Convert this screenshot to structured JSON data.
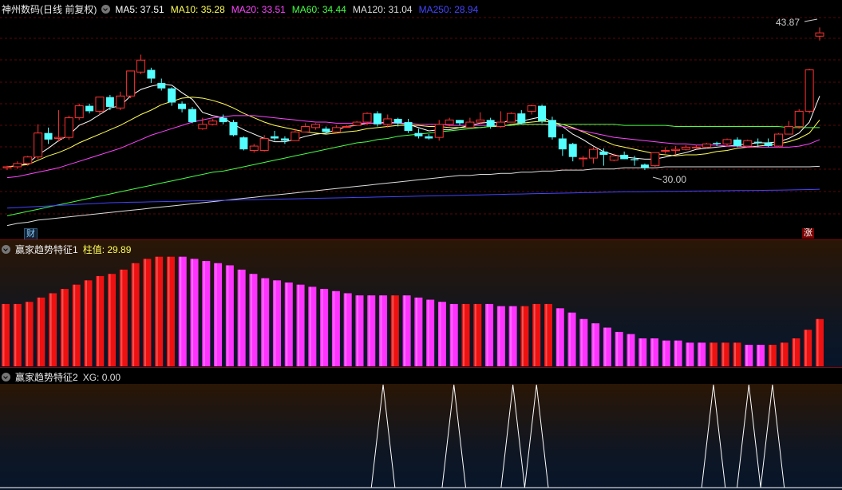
{
  "main": {
    "title": "神州数码(日线 前复权)",
    "indicators": [
      {
        "label": "MA5: 37.51",
        "color": "#ffffff"
      },
      {
        "label": "MA10: 35.28",
        "color": "#ffff55"
      },
      {
        "label": "MA20: 33.51",
        "color": "#ff44ff"
      },
      {
        "label": "MA60: 34.44",
        "color": "#44ff44"
      },
      {
        "label": "MA120: 31.04",
        "color": "#dddddd"
      },
      {
        "label": "MA250: 28.94",
        "color": "#4444ff"
      }
    ],
    "high_label": "43.87",
    "low_label": "30.00",
    "badge_cai": "财",
    "badge_zhang": "涨"
  },
  "indicator1": {
    "title": "赢家趋势特征1",
    "value_label": "柱值: 29.89",
    "bars": [
      {
        "v": 29,
        "c": "r"
      },
      {
        "v": 29,
        "c": "r"
      },
      {
        "v": 30,
        "c": "r"
      },
      {
        "v": 32,
        "c": "r"
      },
      {
        "v": 34,
        "c": "r"
      },
      {
        "v": 36,
        "c": "r"
      },
      {
        "v": 38,
        "c": "r"
      },
      {
        "v": 40,
        "c": "r"
      },
      {
        "v": 42,
        "c": "r"
      },
      {
        "v": 43,
        "c": "r"
      },
      {
        "v": 45,
        "c": "r"
      },
      {
        "v": 48,
        "c": "r"
      },
      {
        "v": 50,
        "c": "r"
      },
      {
        "v": 51,
        "c": "r"
      },
      {
        "v": 51,
        "c": "r"
      },
      {
        "v": 51,
        "c": "m"
      },
      {
        "v": 50,
        "c": "m"
      },
      {
        "v": 49,
        "c": "m"
      },
      {
        "v": 48,
        "c": "m"
      },
      {
        "v": 47,
        "c": "m"
      },
      {
        "v": 45,
        "c": "m"
      },
      {
        "v": 43,
        "c": "m"
      },
      {
        "v": 41,
        "c": "m"
      },
      {
        "v": 40,
        "c": "m"
      },
      {
        "v": 39,
        "c": "m"
      },
      {
        "v": 38,
        "c": "m"
      },
      {
        "v": 37,
        "c": "m"
      },
      {
        "v": 36,
        "c": "m"
      },
      {
        "v": 35,
        "c": "m"
      },
      {
        "v": 34,
        "c": "m"
      },
      {
        "v": 33,
        "c": "m"
      },
      {
        "v": 33,
        "c": "m"
      },
      {
        "v": 33,
        "c": "m"
      },
      {
        "v": 33,
        "c": "r"
      },
      {
        "v": 33,
        "c": "m"
      },
      {
        "v": 32,
        "c": "m"
      },
      {
        "v": 31,
        "c": "m"
      },
      {
        "v": 30,
        "c": "m"
      },
      {
        "v": 29,
        "c": "m"
      },
      {
        "v": 29,
        "c": "r"
      },
      {
        "v": 29,
        "c": "r"
      },
      {
        "v": 29,
        "c": "m"
      },
      {
        "v": 28,
        "c": "m"
      },
      {
        "v": 28,
        "c": "m"
      },
      {
        "v": 28,
        "c": "r"
      },
      {
        "v": 29,
        "c": "r"
      },
      {
        "v": 29,
        "c": "r"
      },
      {
        "v": 27,
        "c": "m"
      },
      {
        "v": 25,
        "c": "m"
      },
      {
        "v": 22,
        "c": "m"
      },
      {
        "v": 20,
        "c": "m"
      },
      {
        "v": 18,
        "c": "m"
      },
      {
        "v": 16,
        "c": "m"
      },
      {
        "v": 15,
        "c": "m"
      },
      {
        "v": 13,
        "c": "m"
      },
      {
        "v": 13,
        "c": "m"
      },
      {
        "v": 12,
        "c": "m"
      },
      {
        "v": 12,
        "c": "m"
      },
      {
        "v": 11,
        "c": "m"
      },
      {
        "v": 11,
        "c": "m"
      },
      {
        "v": 11,
        "c": "r"
      },
      {
        "v": 11,
        "c": "r"
      },
      {
        "v": 11,
        "c": "r"
      },
      {
        "v": 10,
        "c": "m"
      },
      {
        "v": 10,
        "c": "m"
      },
      {
        "v": 10,
        "c": "r"
      },
      {
        "v": 11,
        "c": "r"
      },
      {
        "v": 13,
        "c": "r"
      },
      {
        "v": 17,
        "c": "r"
      },
      {
        "v": 22,
        "c": "r"
      }
    ],
    "colors": {
      "r": "#ee1111",
      "m": "#ff33ff"
    }
  },
  "indicator2": {
    "title": "赢家趋势特征2",
    "value_label": "XG: 0.00",
    "spikes": [
      32,
      38,
      43,
      45,
      60,
      63,
      65
    ]
  },
  "chart_data": {
    "type": "candlestick",
    "candles": [
      [
        30.9,
        31.0,
        30.7,
        31.1
      ],
      [
        31.0,
        31.3,
        30.8,
        31.5
      ],
      [
        31.3,
        31.9,
        31.1,
        32.0
      ],
      [
        31.9,
        34.1,
        31.7,
        34.9
      ],
      [
        34.1,
        33.5,
        33.1,
        34.6
      ],
      [
        33.6,
        33.7,
        33.3,
        36.2
      ],
      [
        33.7,
        35.5,
        33.5,
        35.7
      ],
      [
        35.5,
        36.6,
        35.3,
        36.8
      ],
      [
        36.6,
        36.1,
        35.9,
        36.8
      ],
      [
        36.1,
        37.4,
        35.8,
        37.4
      ],
      [
        37.4,
        36.5,
        36.2,
        37.6
      ],
      [
        36.4,
        37.5,
        36.2,
        37.9
      ],
      [
        37.5,
        39.8,
        37.3,
        39.8
      ],
      [
        39.7,
        40.8,
        39.5,
        41.3
      ],
      [
        39.9,
        39.1,
        38.7,
        40.1
      ],
      [
        38.7,
        38.2,
        38.0,
        39.1
      ],
      [
        38.2,
        36.9,
        36.6,
        38.3
      ],
      [
        36.8,
        36.3,
        36.0,
        37.0
      ],
      [
        36.3,
        35.1,
        35.0,
        36.5
      ],
      [
        34.5,
        34.9,
        34.4,
        35.5
      ],
      [
        34.9,
        35.2,
        34.8,
        35.4
      ],
      [
        35.5,
        35.1,
        34.9,
        35.8
      ],
      [
        35.1,
        33.9,
        33.8,
        35.3
      ],
      [
        33.7,
        32.6,
        32.5,
        33.8
      ],
      [
        32.5,
        32.9,
        32.3,
        33.1
      ],
      [
        32.5,
        33.6,
        32.4,
        33.9
      ],
      [
        33.8,
        33.6,
        33.4,
        34.3
      ],
      [
        33.6,
        33.4,
        33.1,
        33.8
      ],
      [
        33.4,
        34.2,
        33.4,
        34.5
      ],
      [
        34.2,
        34.7,
        34.2,
        35.0
      ],
      [
        34.6,
        34.9,
        34.4,
        35.0
      ],
      [
        34.5,
        34.2,
        34.0,
        34.7
      ],
      [
        34.2,
        34.6,
        34.1,
        34.8
      ],
      [
        34.7,
        34.7,
        34.7,
        34.8
      ],
      [
        34.8,
        35.1,
        34.8,
        35.2
      ],
      [
        35.1,
        35.9,
        34.8,
        36.0
      ],
      [
        35.9,
        34.9,
        34.7,
        36.1
      ],
      [
        34.9,
        35.4,
        34.6,
        35.8
      ],
      [
        35.4,
        35.0,
        34.7,
        35.5
      ],
      [
        35.1,
        34.3,
        34.1,
        35.4
      ],
      [
        34.1,
        33.8,
        33.6,
        34.5
      ],
      [
        33.8,
        33.6,
        33.5,
        34.0
      ],
      [
        33.7,
        34.9,
        33.4,
        35.3
      ],
      [
        34.9,
        35.3,
        34.7,
        35.5
      ],
      [
        35.3,
        35.0,
        34.8,
        35.3
      ],
      [
        34.6,
        35.1,
        34.6,
        35.5
      ],
      [
        35.1,
        35.3,
        34.9,
        36.0
      ],
      [
        35.3,
        34.7,
        34.5,
        35.5
      ],
      [
        34.7,
        35.1,
        34.6,
        36.1
      ],
      [
        35.1,
        35.9,
        35.1,
        36.0
      ],
      [
        35.9,
        35.0,
        34.9,
        36.2
      ],
      [
        36.1,
        36.6,
        35.8,
        36.7
      ],
      [
        36.6,
        35.2,
        35.0,
        36.7
      ],
      [
        35.3,
        33.7,
        33.5,
        35.6
      ],
      [
        33.6,
        32.6,
        32.0,
        34.0
      ],
      [
        33.1,
        31.9,
        31.5,
        33.2
      ],
      [
        31.8,
        31.8,
        31.0,
        32.0
      ],
      [
        31.8,
        32.6,
        31.3,
        32.8
      ],
      [
        32.4,
        32.1,
        31.1,
        32.7
      ],
      [
        31.6,
        32.0,
        31.5,
        32.2
      ],
      [
        32.1,
        31.7,
        31.7,
        32.4
      ],
      [
        31.7,
        31.6,
        31.1,
        32.0
      ],
      [
        31.2,
        30.9,
        30.7,
        31.3
      ],
      [
        31.1,
        32.3,
        31.0,
        32.3
      ],
      [
        32.5,
        32.5,
        32.2,
        32.8
      ],
      [
        32.5,
        32.6,
        32.1,
        32.9
      ],
      [
        32.6,
        32.8,
        32.5,
        33.0
      ],
      [
        32.8,
        32.8,
        32.7,
        33.0
      ],
      [
        32.8,
        33.1,
        32.7,
        33.2
      ],
      [
        33.2,
        33.1,
        32.9,
        33.3
      ],
      [
        33.1,
        33.5,
        32.9,
        33.6
      ],
      [
        33.5,
        32.9,
        32.8,
        33.7
      ],
      [
        32.9,
        33.4,
        32.8,
        33.5
      ],
      [
        33.3,
        33.2,
        32.8,
        33.6
      ],
      [
        33.2,
        32.9,
        32.8,
        33.6
      ],
      [
        32.9,
        34.0,
        32.8,
        34.1
      ],
      [
        34.0,
        34.7,
        34.0,
        35.2
      ],
      [
        34.7,
        36.1,
        34.5,
        36.3
      ],
      [
        36.1,
        39.9,
        35.9,
        40.0
      ],
      [
        43.0,
        43.3,
        42.6,
        43.8
      ]
    ],
    "moving_averages": [
      {
        "name": "MA5",
        "color": "#ffffff",
        "values": [
          31.0,
          31.1,
          31.3,
          32.1,
          32.7,
          33.4,
          33.9,
          34.8,
          35.2,
          35.8,
          36.4,
          36.6,
          37.5,
          38.1,
          38.4,
          38.6,
          38.5,
          37.8,
          37.2,
          36.0,
          35.7,
          35.5,
          34.9,
          34.4,
          34.0,
          33.6,
          33.3,
          33.3,
          33.5,
          33.8,
          34.0,
          34.1,
          34.4,
          34.7,
          34.8,
          35.0,
          35.0,
          35.1,
          35.0,
          34.9,
          34.6,
          34.3,
          34.4,
          34.4,
          34.6,
          34.8,
          35.0,
          35.1,
          35.0,
          35.3,
          35.2,
          35.4,
          35.6,
          35.1,
          34.7,
          34.0,
          33.5,
          32.9,
          32.4,
          32.1,
          31.9,
          31.8,
          31.7,
          31.7,
          31.9,
          32.1,
          32.3,
          32.6,
          32.7,
          32.8,
          32.9,
          33.0,
          33.1,
          33.2,
          33.2,
          33.3,
          33.6,
          34.1,
          35.1,
          37.5
        ]
      },
      {
        "name": "MA10",
        "color": "#ffff55",
        "values": [
          31.0,
          31.1,
          31.2,
          31.6,
          32.0,
          32.3,
          32.7,
          33.2,
          33.6,
          34.0,
          34.4,
          34.8,
          35.3,
          35.8,
          36.2,
          36.7,
          37.0,
          37.3,
          37.4,
          37.3,
          37.1,
          36.8,
          36.4,
          35.9,
          35.5,
          35.1,
          34.8,
          34.6,
          34.4,
          34.2,
          34.1,
          34.0,
          34.1,
          34.2,
          34.3,
          34.5,
          34.6,
          34.7,
          34.8,
          34.8,
          34.8,
          34.7,
          34.7,
          34.6,
          34.6,
          34.6,
          34.6,
          34.7,
          34.7,
          34.9,
          35.0,
          35.1,
          35.2,
          35.1,
          34.9,
          34.6,
          34.2,
          33.8,
          33.4,
          33.0,
          32.8,
          32.6,
          32.4,
          32.2,
          32.1,
          32.0,
          32.1,
          32.1,
          32.2,
          32.4,
          32.5,
          32.7,
          32.8,
          32.9,
          33.0,
          33.1,
          33.3,
          33.6,
          34.1,
          35.3
        ]
      },
      {
        "name": "MA20",
        "color": "#ff44ff",
        "values": [
          30.0,
          30.1,
          30.3,
          30.5,
          30.7,
          30.9,
          31.2,
          31.5,
          31.8,
          32.1,
          32.4,
          32.7,
          33.1,
          33.5,
          33.9,
          34.2,
          34.5,
          34.8,
          35.1,
          35.3,
          35.5,
          35.6,
          35.7,
          35.7,
          35.7,
          35.6,
          35.5,
          35.4,
          35.3,
          35.2,
          35.1,
          35.1,
          35.0,
          35.0,
          35.0,
          35.0,
          35.0,
          35.0,
          35.0,
          35.0,
          34.9,
          34.9,
          34.9,
          34.8,
          34.8,
          34.8,
          34.8,
          34.8,
          34.8,
          34.8,
          34.9,
          34.9,
          34.9,
          34.8,
          34.7,
          34.5,
          34.3,
          34.1,
          33.9,
          33.7,
          33.6,
          33.5,
          33.4,
          33.3,
          33.2,
          33.1,
          33.1,
          33.0,
          33.0,
          33.0,
          32.9,
          32.9,
          32.8,
          32.8,
          32.8,
          32.8,
          32.8,
          32.9,
          33.1,
          33.5
        ]
      },
      {
        "name": "MA60",
        "color": "#44ff44",
        "values": [
          26.5,
          26.7,
          26.9,
          27.1,
          27.3,
          27.5,
          27.7,
          27.9,
          28.1,
          28.3,
          28.5,
          28.7,
          28.9,
          29.1,
          29.3,
          29.5,
          29.7,
          29.9,
          30.1,
          30.3,
          30.5,
          30.6,
          30.8,
          31.0,
          31.2,
          31.4,
          31.6,
          31.8,
          32.0,
          32.2,
          32.4,
          32.6,
          32.8,
          33.0,
          33.2,
          33.3,
          33.5,
          33.6,
          33.8,
          33.9,
          34.0,
          34.1,
          34.2,
          34.3,
          34.4,
          34.5,
          34.6,
          34.7,
          34.8,
          34.8,
          34.9,
          34.9,
          34.9,
          34.9,
          34.9,
          34.9,
          34.9,
          34.9,
          34.9,
          34.9,
          34.8,
          34.8,
          34.8,
          34.8,
          34.8,
          34.7,
          34.7,
          34.7,
          34.7,
          34.7,
          34.7,
          34.7,
          34.7,
          34.7,
          34.7,
          34.7,
          34.6,
          34.6,
          34.6,
          34.6
        ]
      },
      {
        "name": "MA120",
        "color": "#dddddd",
        "values": [
          25.6,
          25.8,
          25.9,
          26.1,
          26.2,
          26.3,
          26.4,
          26.5,
          26.6,
          26.7,
          26.8,
          26.9,
          27.0,
          27.1,
          27.2,
          27.3,
          27.4,
          27.5,
          27.6,
          27.7,
          27.8,
          27.9,
          28.0,
          28.1,
          28.2,
          28.3,
          28.4,
          28.5,
          28.6,
          28.7,
          28.8,
          28.9,
          29.0,
          29.1,
          29.2,
          29.3,
          29.4,
          29.5,
          29.6,
          29.7,
          29.8,
          29.9,
          30.0,
          30.1,
          30.2,
          30.2,
          30.3,
          30.3,
          30.4,
          30.4,
          30.5,
          30.5,
          30.6,
          30.6,
          30.7,
          30.7,
          30.7,
          30.8,
          30.8,
          30.8,
          30.9,
          30.9,
          30.9,
          30.9,
          31.0,
          31.0,
          31.0,
          31.0,
          31.0,
          31.0,
          31.0,
          31.0,
          31.0,
          31.0,
          31.0,
          31.0,
          31.0,
          31.0,
          31.0,
          31.04
        ]
      },
      {
        "name": "MA250",
        "color": "#4444ff",
        "values": [
          27.2,
          27.25,
          27.3,
          27.35,
          27.4,
          27.45,
          27.5,
          27.55,
          27.6,
          27.65,
          27.7,
          27.72,
          27.74,
          27.76,
          27.78,
          27.8,
          27.82,
          27.84,
          27.86,
          27.88,
          27.9,
          27.92,
          27.94,
          27.96,
          27.98,
          28.0,
          28.02,
          28.04,
          28.06,
          28.08,
          28.1,
          28.12,
          28.14,
          28.16,
          28.18,
          28.2,
          28.22,
          28.24,
          28.26,
          28.28,
          28.3,
          28.32,
          28.34,
          28.36,
          28.38,
          28.4,
          28.42,
          28.44,
          28.46,
          28.48,
          28.5,
          28.52,
          28.54,
          28.56,
          28.58,
          28.6,
          28.62,
          28.64,
          28.66,
          28.68,
          28.7,
          28.71,
          28.72,
          28.73,
          28.74,
          28.75,
          28.76,
          28.77,
          28.78,
          28.79,
          28.8,
          28.81,
          28.82,
          28.83,
          28.84,
          28.85,
          28.87,
          28.89,
          28.91,
          28.94
        ]
      }
    ],
    "ylim": [
      25.5,
      45.0
    ],
    "up_color": "#ff3232",
    "down_color": "#54ffff"
  }
}
